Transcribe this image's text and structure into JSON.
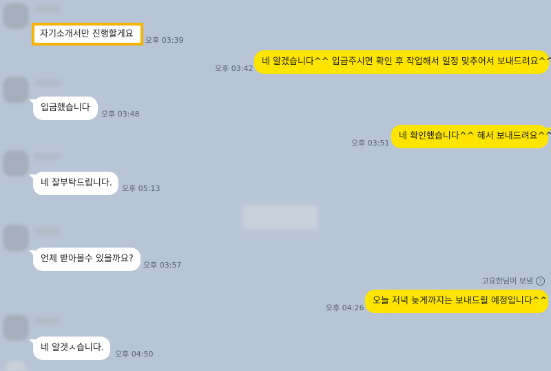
{
  "messages": [
    {
      "text": "자기소개서만 진행할게요",
      "time": "오후 03:39"
    },
    {
      "text": "네 알겠습니다^^ 입금주시면 확인 후 작업해서 일정 맞추어서 보내드려요^^",
      "time": "오후 03:42"
    },
    {
      "text": "입금했습니다",
      "time": "오후 03:48"
    },
    {
      "text": "네 확인했습니다^^ 해서 보내드려요^^",
      "time": "오후 03:51"
    },
    {
      "text": "네 잘부탁드립니다.",
      "time": "오후 05:13"
    },
    {
      "text": "언제 받아볼수 있을까요?",
      "time": "오후 03:57"
    },
    {
      "text": "오늘 저녁 늦게까지는 보내드릴 예정입니다^^",
      "time": "오후 04:26"
    },
    {
      "text": "네 알겟ㅅ습니다.",
      "time": "오후 04:50"
    }
  ],
  "sender_note": "고요한님이 보냄",
  "help_icon": "question-circle-icon",
  "colors": {
    "background": "#b8c5d6",
    "outgoing": "#fee500",
    "incoming": "#ffffff",
    "highlight": "#f5b400"
  }
}
